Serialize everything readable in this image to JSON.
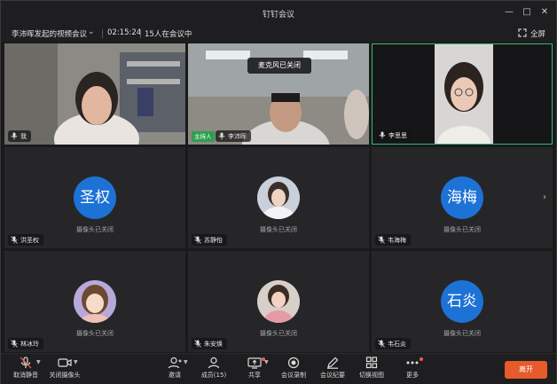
{
  "window": {
    "title": "钉钉会议"
  },
  "info": {
    "meeting_name": "李沛晖发起的视频会议",
    "timer": "02:15:24",
    "count": "15人在会议中",
    "fullscreen": "全屏"
  },
  "tiles": [
    {
      "name": "我",
      "state": "video"
    },
    {
      "name": "李沛晖",
      "host": "主持人",
      "toast": "麦克风已关闭",
      "state": "video"
    },
    {
      "name": "李思思",
      "state": "video"
    },
    {
      "name": "洪圣权",
      "avatar_text": "圣权",
      "status": "摄像头已关闭"
    },
    {
      "name": "苏静怡",
      "status": "摄像头已关闭"
    },
    {
      "name": "韦海梅",
      "avatar_text": "海梅",
      "status": "摄像头已关闭"
    },
    {
      "name": "林冰玲",
      "status": "摄像头已关闭"
    },
    {
      "name": "朱安焕",
      "status": "摄像头已关闭"
    },
    {
      "name": "韦石炎",
      "avatar_text": "石炎",
      "status": "摄像头已关闭"
    }
  ],
  "toolbar": {
    "unmute": "取消静音",
    "camera": "关闭摄像头",
    "invite": "邀请",
    "members": "成员(15)",
    "share": "共享",
    "record": "会议录制",
    "minutes": "会议纪要",
    "switch_view": "切换视图",
    "more": "更多",
    "leave": "离开"
  },
  "colors": {
    "accent_blue": "#1d72d6",
    "leave": "#e65a2b",
    "active_border": "#2fbf71",
    "host_badge": "#2f9e4f"
  }
}
